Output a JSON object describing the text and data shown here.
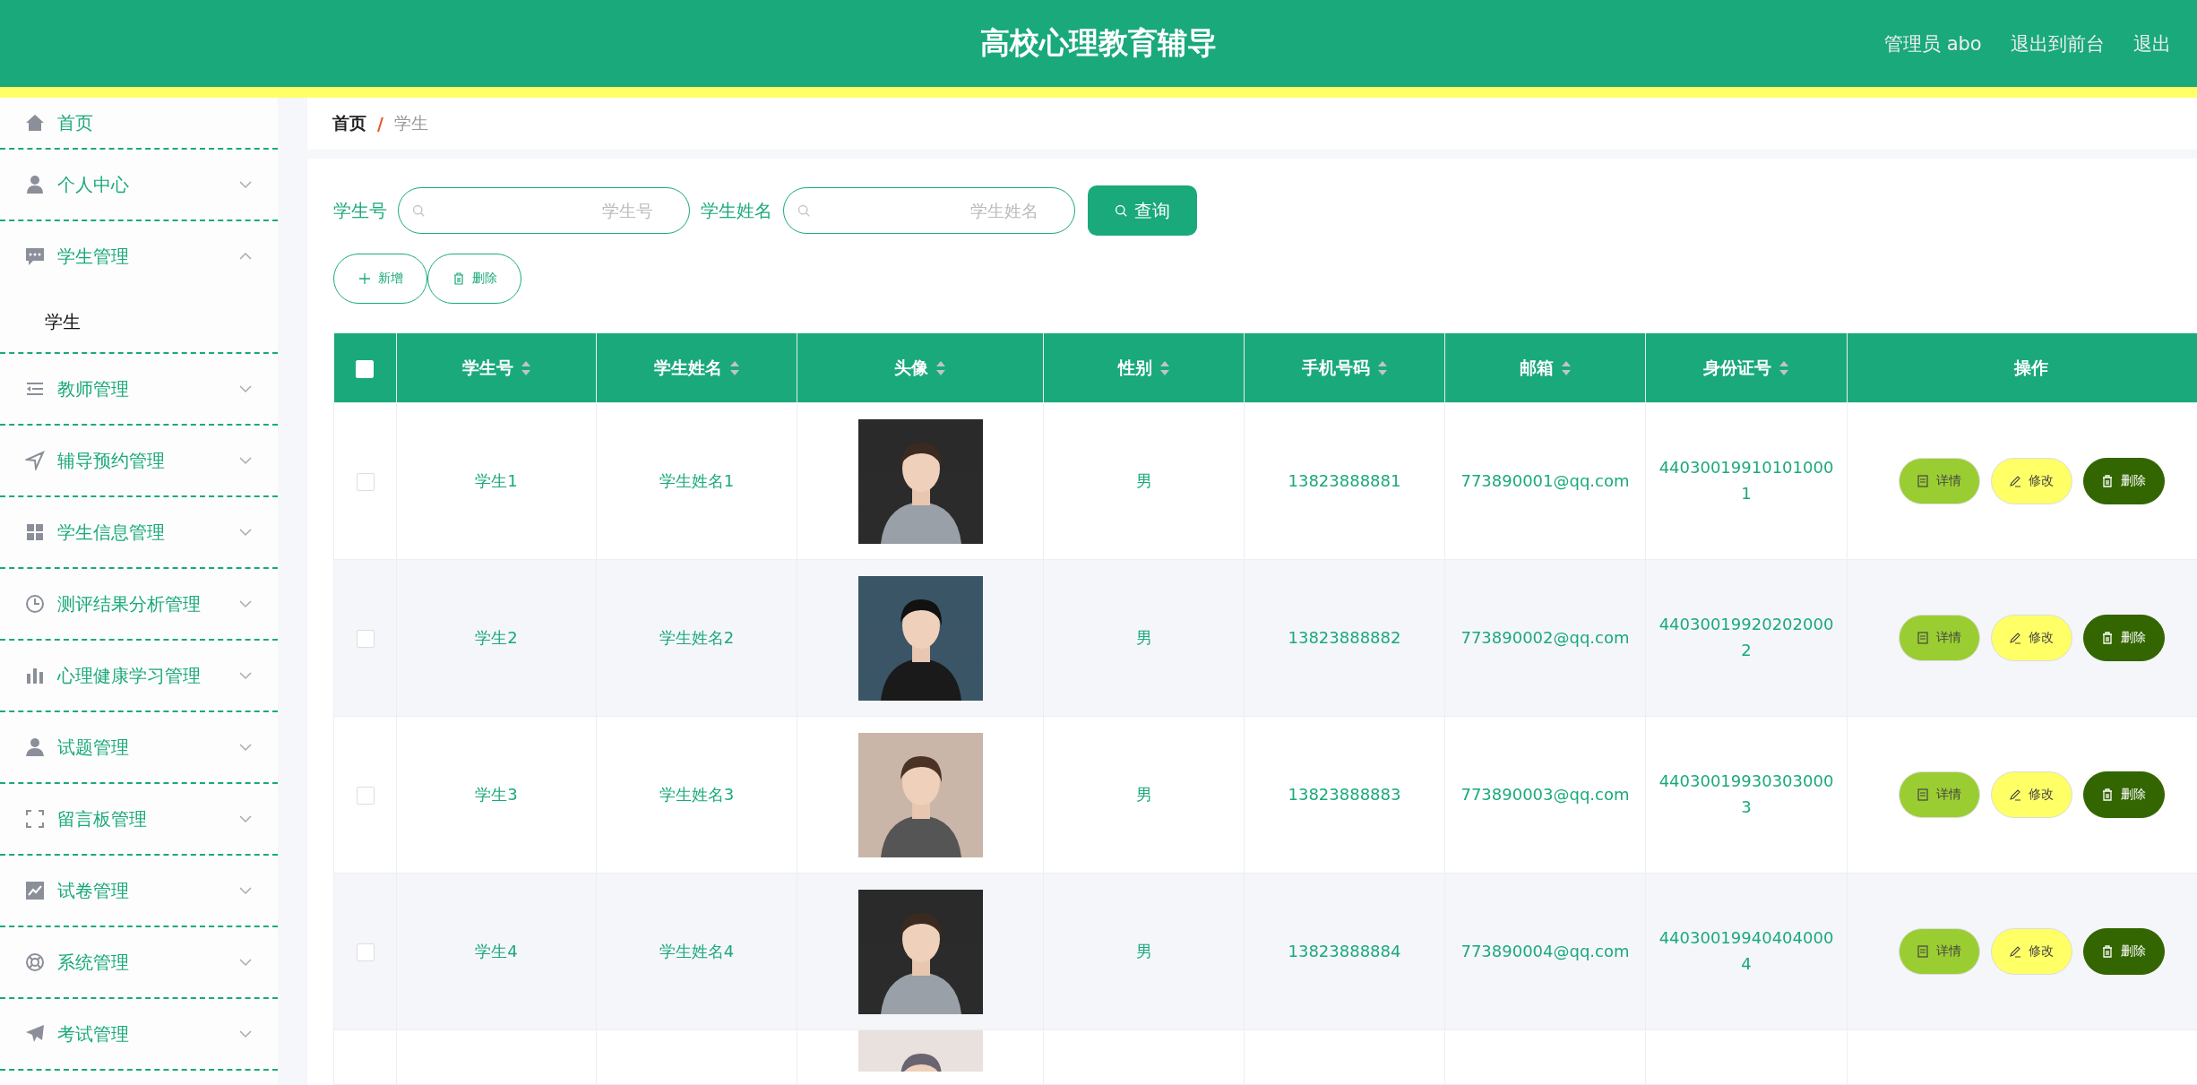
{
  "header": {
    "title": "高校心理教育辅导",
    "links": [
      "管理员 abo",
      "退出到前台",
      "退出"
    ]
  },
  "sidebar": {
    "items": [
      {
        "kind": "link",
        "label": "首页"
      },
      {
        "kind": "menu",
        "label": "个人中心",
        "expanded": false
      },
      {
        "kind": "menu",
        "label": "学生管理",
        "expanded": true,
        "children": [
          {
            "label": "学生",
            "selected": true
          }
        ]
      },
      {
        "kind": "menu",
        "label": "教师管理",
        "expanded": false
      },
      {
        "kind": "menu",
        "label": "辅导预约管理",
        "expanded": false
      },
      {
        "kind": "menu",
        "label": "学生信息管理",
        "expanded": false
      },
      {
        "kind": "menu",
        "label": "测评结果分析管理",
        "expanded": false
      },
      {
        "kind": "menu",
        "label": "心理健康学习管理",
        "expanded": false
      },
      {
        "kind": "menu",
        "label": "试题管理",
        "expanded": false
      },
      {
        "kind": "menu",
        "label": "留言板管理",
        "expanded": false
      },
      {
        "kind": "menu",
        "label": "试卷管理",
        "expanded": false
      },
      {
        "kind": "menu",
        "label": "系统管理",
        "expanded": false
      },
      {
        "kind": "menu",
        "label": "考试管理",
        "expanded": false
      }
    ]
  },
  "breadcrumb": {
    "items": [
      "首页",
      "学生"
    ],
    "separator": "/"
  },
  "search": {
    "fields": [
      {
        "label": "学生号",
        "placeholder": "学生号"
      },
      {
        "label": "学生姓名",
        "placeholder": "学生姓名"
      }
    ],
    "button": "查询"
  },
  "actions": [
    "新增",
    "删除"
  ],
  "table": {
    "select_all": {
      "checked": false
    },
    "columns": [
      {
        "label": "学生号",
        "sortable": true
      },
      {
        "label": "学生姓名",
        "sortable": true
      },
      {
        "label": "头像",
        "sortable": true
      },
      {
        "label": "性别",
        "sortable": true
      },
      {
        "label": "手机号码",
        "sortable": true
      },
      {
        "label": "邮箱",
        "sortable": true
      },
      {
        "label": "身份证号",
        "sortable": true
      },
      {
        "label": "操作",
        "sortable": false
      }
    ],
    "rows": [
      {
        "checked": false,
        "student_no": "学生1",
        "name": "学生姓名1",
        "avatar": {
          "kind": "picture"
        },
        "gender": "男",
        "phone": "13823888881",
        "email": "773890001@qq.com",
        "id_number": "440300199101010001",
        "buttons": [
          "详情",
          "修改",
          "删除"
        ]
      },
      {
        "checked": false,
        "student_no": "学生2",
        "name": "学生姓名2",
        "avatar": {
          "kind": "picture"
        },
        "gender": "男",
        "phone": "13823888882",
        "email": "773890002@qq.com",
        "id_number": "440300199202020002",
        "buttons": [
          "详情",
          "修改",
          "删除"
        ]
      },
      {
        "checked": false,
        "student_no": "学生3",
        "name": "学生姓名3",
        "avatar": {
          "kind": "picture"
        },
        "gender": "男",
        "phone": "13823888883",
        "email": "773890003@qq.com",
        "id_number": "440300199303030003",
        "buttons": [
          "详情",
          "修改",
          "删除"
        ]
      },
      {
        "checked": false,
        "student_no": "学生4",
        "name": "学生姓名4",
        "avatar": {
          "kind": "picture"
        },
        "gender": "男",
        "phone": "13823888884",
        "email": "773890004@qq.com",
        "id_number": "440300199404040004",
        "buttons": [
          "详情",
          "修改",
          "删除"
        ]
      },
      {
        "avatar": {
          "kind": "picture"
        }
      }
    ]
  }
}
